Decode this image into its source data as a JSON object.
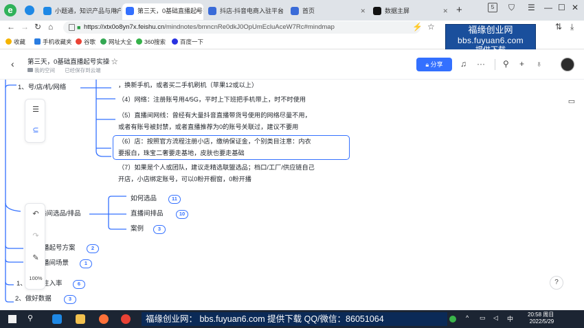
{
  "tabs": [
    {
      "label": "小题通，知识产品与用户",
      "active": false,
      "color": "#1e88e5"
    },
    {
      "label": "第三天，0基础直播起号实操",
      "active": true,
      "color": "#3370ff"
    },
    {
      "label": "抖店-抖音电商入驻平台",
      "active": false,
      "color": "#3a6bd8"
    },
    {
      "label": "首页",
      "active": false,
      "color": "#3a6bd8"
    },
    {
      "label": "数据主屏",
      "active": false,
      "color": "#111111"
    }
  ],
  "browser": {
    "url_host": "https://xtx0o8yn7x.feishu.cn",
    "url_path": "/mindnotes/bmncnRe0dkJ0OpUmEcluAceW7Rc#mindmap",
    "tab_count": "5"
  },
  "bookmarks": [
    {
      "label": "收藏",
      "color": "#f5b400"
    },
    {
      "label": "手机收藏夹",
      "color": "#2a7de1"
    },
    {
      "label": "谷歌",
      "color": "#ea4335"
    },
    {
      "label": "网址大全",
      "color": "#34a853"
    },
    {
      "label": "360搜索",
      "color": "#36b24a"
    },
    {
      "label": "百度一下",
      "color": "#2932e1"
    }
  ],
  "banner": {
    "line1": "福缘创业网",
    "line2": "bbs.fuyuan6.com",
    "line3": "提供下载"
  },
  "doc": {
    "title": "第三天，0基础直播起号实操",
    "star": "☆",
    "location": "我的空间",
    "saved": "已经保存到云端",
    "share_label": "分享"
  },
  "mindmap": {
    "branch1": "1、号/店/机/网络",
    "paragraphs": [
      "，换新手机，或者买二手机刷机（苹果12或以上）",
      "（4）网络：注册账号用4/5G，平时上下班把手机带上，时不时使用",
      "（5）直播间网线：曾经有大量抖音直播带货号使用的网络尽量不用，",
      "或者有账号被封禁，或者直播推荐为0的账号关联过，建议不要用",
      "（6）店：按照官方流程注册小店，缴纳保证金，个别类目注意：内衣",
      "要报白，珠宝二奢要走基地，皮肤也要走基础",
      "（7）如果是个人或团队，建议走精选联盟选品；档口/工厂/供应链自己",
      "开店，小店绑定账号，可以0粉开橱窗，0粉开播"
    ],
    "branch_select": "播间选品/排品",
    "select_children": [
      {
        "label": "如何选品",
        "count": "11"
      },
      {
        "label": "直播间排品",
        "count": "10"
      },
      {
        "label": "案例",
        "count": "3"
      }
    ],
    "branch_qihao": {
      "label": "播起号方案",
      "count": "2"
    },
    "branch_scene": {
      "label": "播间场景",
      "count": "1"
    },
    "branch_entry": {
      "label": "1、",
      "label2": "注入率",
      "count": "6"
    },
    "branch_data": {
      "label": "2、做好数据",
      "count": "3"
    },
    "zoom": "100%"
  },
  "taskbar": {
    "watermark": "福缘创业网： bbs.fuyuan6.com  提供下载    QQ/微信：86051064",
    "time": "20:58 周日",
    "date": "2022/5/29"
  }
}
